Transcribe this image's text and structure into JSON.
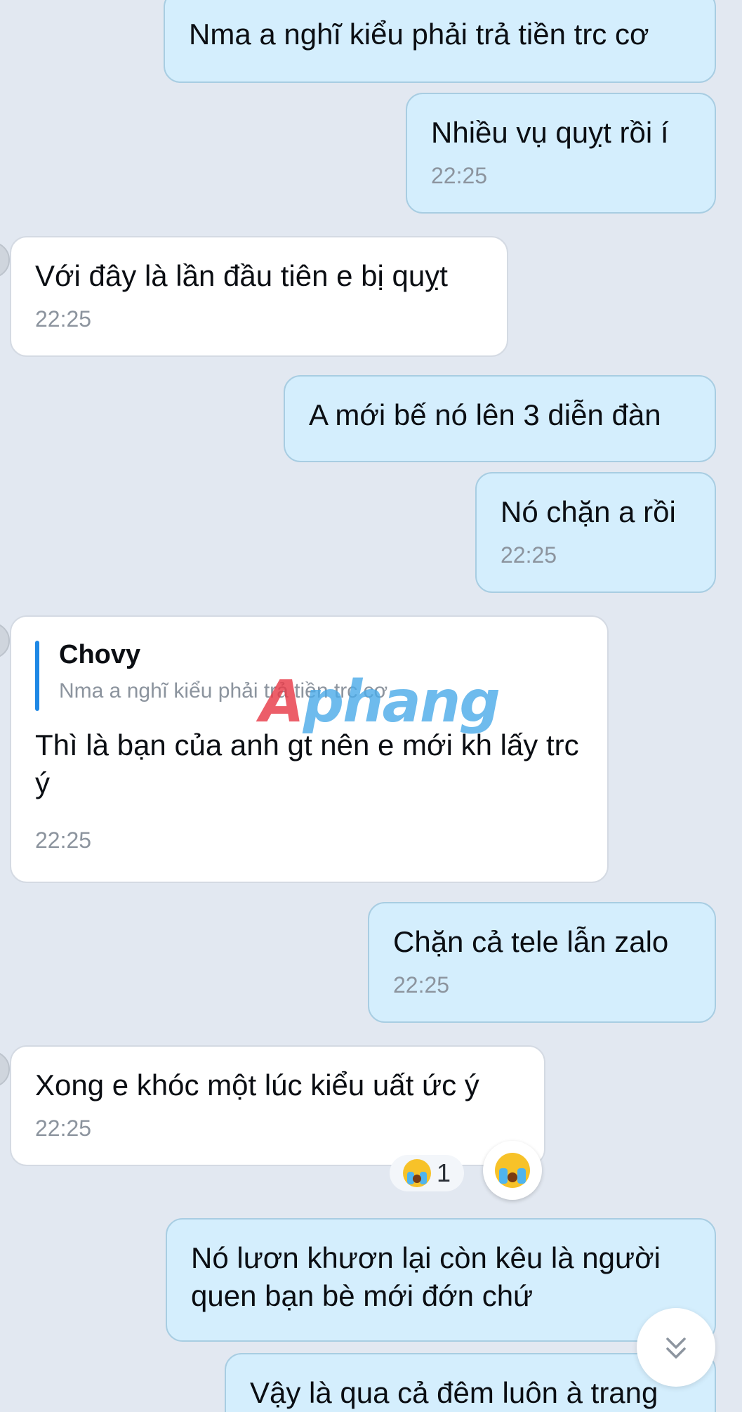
{
  "messages": [
    {
      "direction": "out",
      "text": "Nma a nghĩ kiểu phải trả tiền trc cơ",
      "time": ""
    },
    {
      "direction": "out",
      "text": "Nhiều vụ quỵt rồi í",
      "time": "22:25"
    },
    {
      "direction": "in",
      "text": "Với đây là lần đầu tiên e bị quỵt",
      "time": "22:25"
    },
    {
      "direction": "out",
      "text": "A mới bế nó lên 3 diễn đàn",
      "time": ""
    },
    {
      "direction": "out",
      "text": "Nó chặn a rồi",
      "time": "22:25"
    },
    {
      "direction": "in",
      "reply_to": {
        "name": "Chovy",
        "text": "Nma a nghĩ kiểu phải trả tiền trc cơ"
      },
      "text": "Thì là bạn của anh gt nên e mới kh lấy trc ý",
      "time": "22:25"
    },
    {
      "direction": "out",
      "text": "Chặn cả tele lẫn zalo",
      "time": "22:25"
    },
    {
      "direction": "in",
      "text": "Xong e khóc một lúc kiểu uất ức ý",
      "time": "22:25"
    },
    {
      "direction": "out",
      "text": "Nó lươn khươn lại còn kêu là người quen bạn bè mới đớn chứ",
      "time": ""
    },
    {
      "direction": "out",
      "text": "Vậy là qua cả đêm luôn à trang",
      "time": ""
    }
  ],
  "reaction": {
    "emoji": "crying-face",
    "count": "1"
  },
  "watermark": {
    "first": "A",
    "rest": "phang"
  },
  "colors": {
    "background": "#e2e8f1",
    "outgoing_bubble": "#d4eefd",
    "incoming_bubble": "#ffffff",
    "quote_bar": "#1e88e5",
    "timestamp": "#8c949e"
  },
  "icons": {
    "scroll_down": "double-chevron-down-icon",
    "reaction": "crying-face-icon"
  }
}
